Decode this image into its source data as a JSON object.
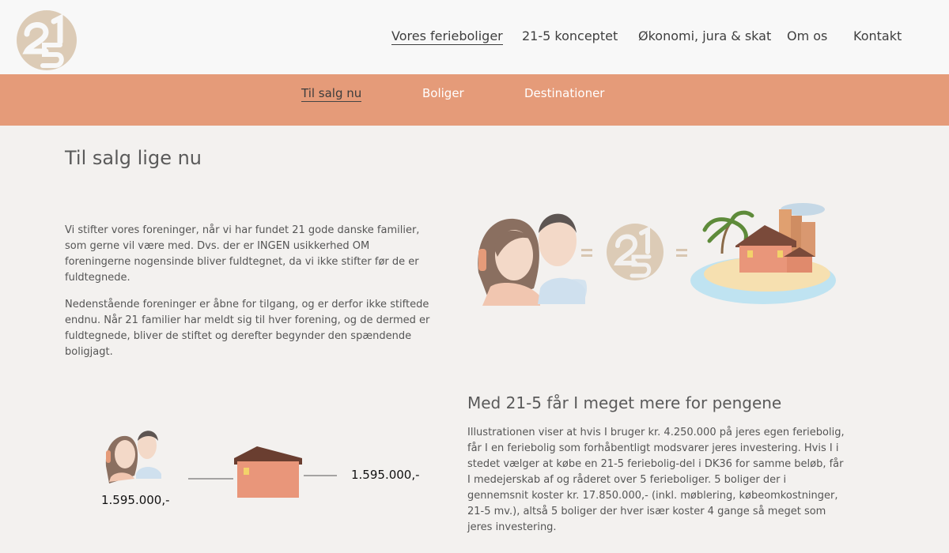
{
  "header": {
    "logo_text": "21-5",
    "nav": [
      {
        "label": "Vores ferieboliger",
        "active": true
      },
      {
        "label": "21-5 konceptet",
        "active": false
      },
      {
        "label": "Økonomi, jura & skat",
        "active": false
      },
      {
        "label": "Om os",
        "active": false
      },
      {
        "label": "Kontakt",
        "active": false
      }
    ]
  },
  "subnav": [
    {
      "label": "Til salg nu",
      "active": true
    },
    {
      "label": "Boliger",
      "active": false
    },
    {
      "label": "Destinationer",
      "active": false
    }
  ],
  "main": {
    "title": "Til salg lige nu",
    "paragraphs": [
      "Vi stifter vores foreninger, når vi har fundet 21 gode danske familier, som gerne vil være med. Dvs. der er INGEN usikkerhed OM foreningerne nogensinde bliver fuldtegnet, da vi ikke stifter før de er fuldtegnede.",
      "Nedenstående foreninger er åbne for tilgang, og er derfor ikke stiftede endnu. Når 21 familier har meldt sig til hver forening, og de dermed er fuldtegnede, bliver de stiftet og derefter begynder den spændende boligjagt."
    ],
    "section": {
      "heading": "Med 21-5 får I meget mere for pengene",
      "body": "Illustrationen viser at hvis I bruger kr. 4.250.000 på jeres egen feriebolig, får I en feriebolig som forhåbentligt modsvarer jeres investering. Hvis I i stedet vælger at købe en 21-5 feriebolig-del i DK36 for samme beløb, får I medejerskab af og råderet over 5 ferieboliger. 5 boliger der i gennemsnit koster kr. 17.850.000,- (inkl. møblering, købeomkostninger, 21-5 mv.), altså 5 boliger der hver især koster 4 gange så meget som jeres investering."
    },
    "prices": {
      "left": "1.595.000,-",
      "right": "1.595.000,-"
    }
  },
  "colors": {
    "accent": "#e59b79",
    "logo": "#dccbb6",
    "background": "#f3f1ef"
  }
}
